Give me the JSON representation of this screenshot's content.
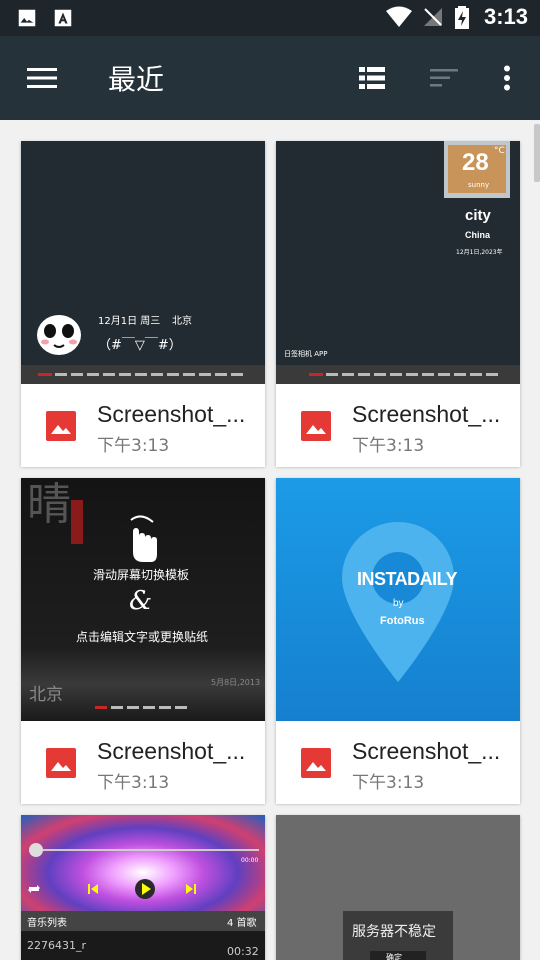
{
  "status_bar": {
    "time": "3:13"
  },
  "toolbar": {
    "title": "最近"
  },
  "files": [
    {
      "name": "Screenshot_...",
      "time": "下午3:13"
    },
    {
      "name": "Screenshot_...",
      "time": "下午3:13"
    },
    {
      "name": "Screenshot_...",
      "time": "下午3:13"
    },
    {
      "name": "Screenshot_...",
      "time": "下午3:13"
    }
  ],
  "thumb1": {
    "date": "12月1日 周三",
    "city": "北京",
    "face": "（#￣▽￣#）"
  },
  "thumb2": {
    "temp": "28",
    "unit": "°C",
    "cond": "sunny",
    "city": "city",
    "country": "China",
    "date": "12月1日,2023年",
    "brand": "日签相机 APP"
  },
  "thumb3": {
    "line1": "滑动屏幕切换模板",
    "amp": "&",
    "line2": "点击编辑文字或更换贴纸",
    "city": "北京",
    "date": "5月8日,2013",
    "big_char": "晴"
  },
  "thumb4": {
    "brand": "INSTADAILY",
    "by": "by",
    "maker": "FotoRus"
  },
  "thumb5": {
    "time_start": "00:00",
    "list_label": "音乐列表",
    "count": "4 首歌",
    "track": "2276431_r",
    "duration": "00:32"
  },
  "thumb6": {
    "dialog": "服务器不稳定",
    "button": "确定"
  },
  "colors": {
    "toolbar": "#26323a",
    "status_bar": "#1e262b",
    "image_icon": "#e53935",
    "blue_tile": "#1a8fdd"
  }
}
